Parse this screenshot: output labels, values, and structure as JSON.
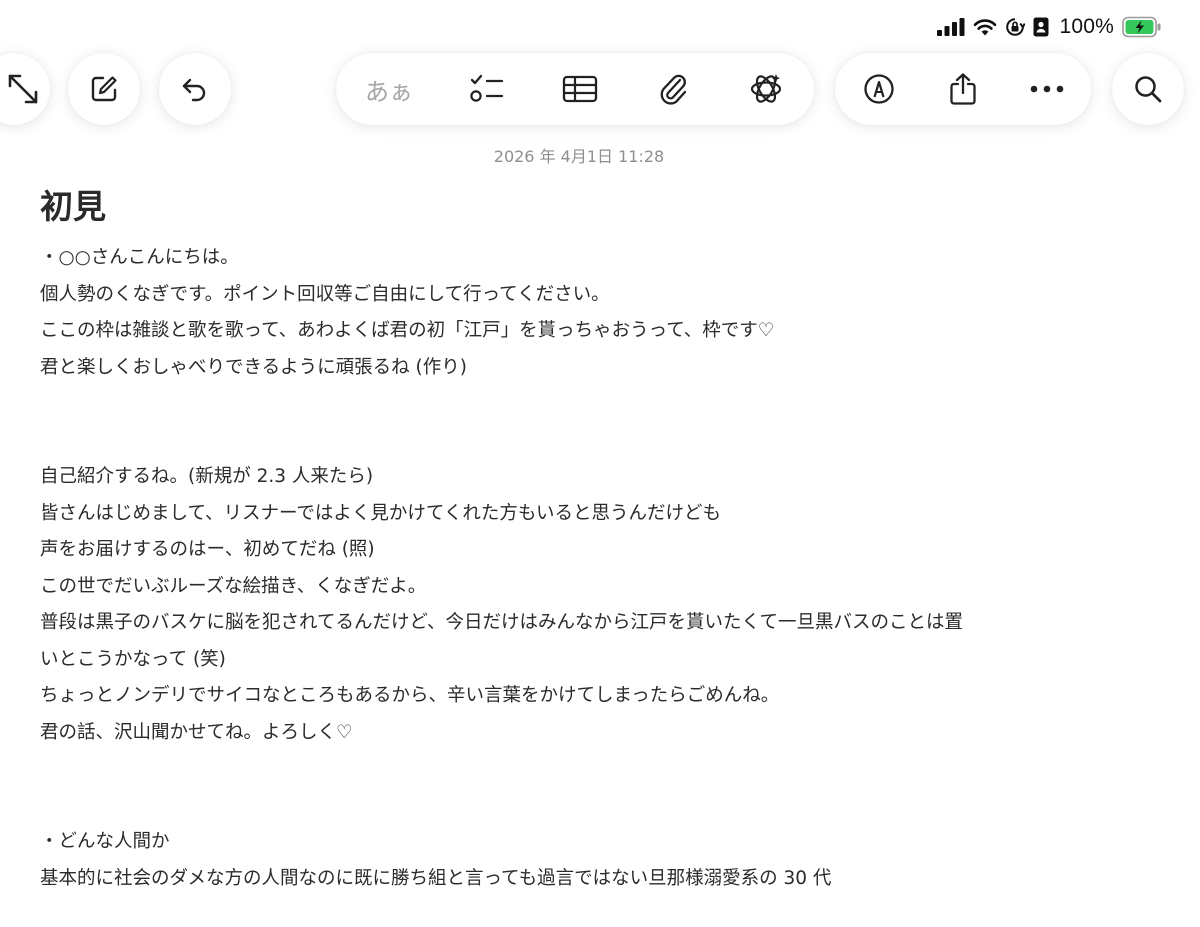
{
  "status_bar": {
    "battery_percent": "100%"
  },
  "toolbar": {
    "format_label": "あぁ"
  },
  "note": {
    "date": "2026 年 4月1日 11:28",
    "title": "初見",
    "lines": [
      "・○○さんこんにちは。",
      "個人勢のくなぎです。ポイント回収等ご自由にして行ってください。",
      "ここの枠は雑談と歌を歌って、あわよくば君の初「江戸」を貰っちゃおうって、枠です♡",
      "君と楽しくおしゃべりできるように頑張るね (作り)",
      "",
      "",
      "自己紹介するね。(新規が 2.3 人来たら)",
      "皆さんはじめまして、リスナーではよく見かけてくれた方もいると思うんだけども",
      "声をお届けするのはー、初めてだね (照)",
      "この世でだいぶルーズな絵描き、くなぎだよ。",
      "普段は黒子のバスケに脳を犯されてるんだけど、今日だけはみんなから江戸を貰いたくて一旦黒バスのことは置",
      "いとこうかなって (笑)",
      "ちょっとノンデリでサイコなところもあるから、辛い言葉をかけてしまったらごめんね。",
      "君の話、沢山聞かせてね。よろしく♡",
      "",
      "",
      "・どんな人間か",
      "基本的に社会のダメな方の人間なのに既に勝ち組と言っても過言ではない旦那様溺愛系の 30 代"
    ]
  }
}
